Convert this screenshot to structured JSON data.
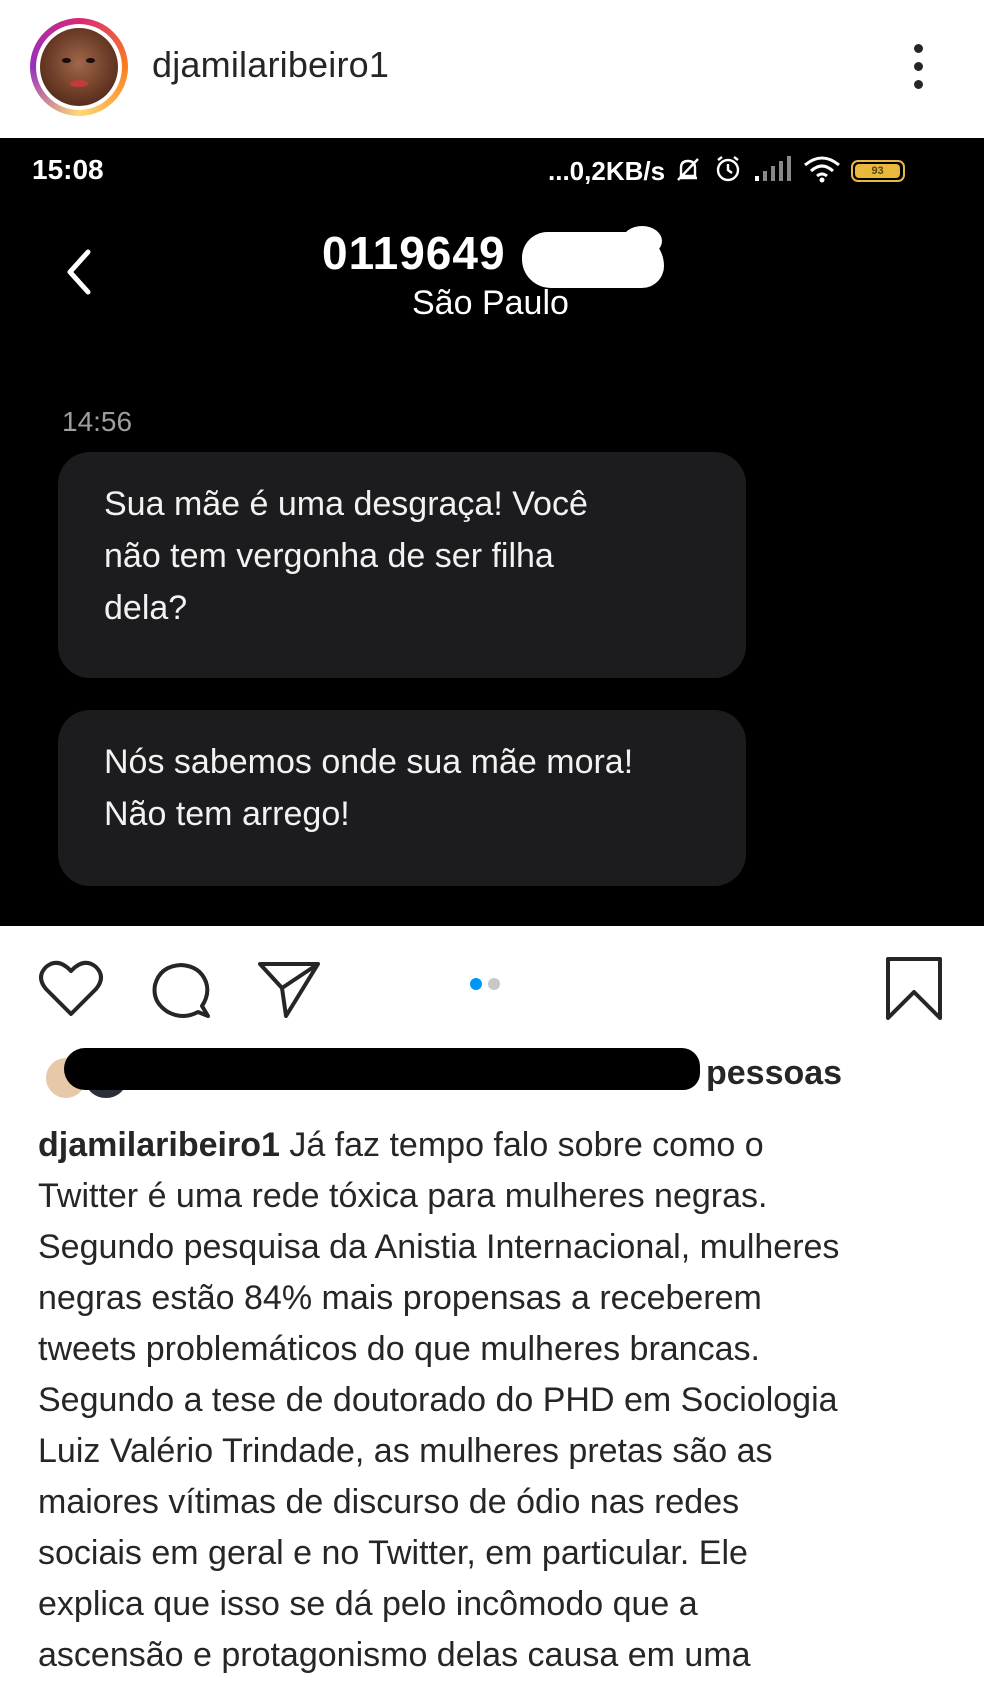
{
  "post": {
    "username": "djamilaribeiro1",
    "more_icon": "more-vertical-icon"
  },
  "screenshot": {
    "status": {
      "time": "15:08",
      "speed": "...0,2KB/s",
      "battery": "93"
    },
    "contact": {
      "number": "0119649",
      "city": "São Paulo"
    },
    "message_time": "14:56",
    "messages": [
      "Sua mãe é uma desgraça! Você\nnão tem vergonha de ser filha\ndela?",
      "Nós sabemos onde sua mãe mora!\nNão tem arrego!"
    ]
  },
  "actions": {
    "icons": [
      "heart-icon",
      "comment-icon",
      "share-icon",
      "bookmark-icon"
    ],
    "carousel_count": 2,
    "carousel_active": 0
  },
  "likes": {
    "text": "pessoas"
  },
  "caption": {
    "username": "djamilaribeiro1",
    "text": " Já faz tempo falo sobre como o\nTwitter é uma rede tóxica para mulheres negras.\nSegundo pesquisa da Anistia Internacional, mulheres\nnegras estão 84% mais propensas a receberem\ntweets problemáticos do que mulheres brancas.\nSegundo a tese de doutorado do PHD em Sociologia\nLuiz Valério Trindade, as mulheres pretas são as\nmaiores vítimas de discurso de ódio nas redes\nsociais em geral e no Twitter, em particular. Ele\nexplica que isso se dá pelo incômodo que a\nascensão e protagonismo delas causa em uma"
  }
}
